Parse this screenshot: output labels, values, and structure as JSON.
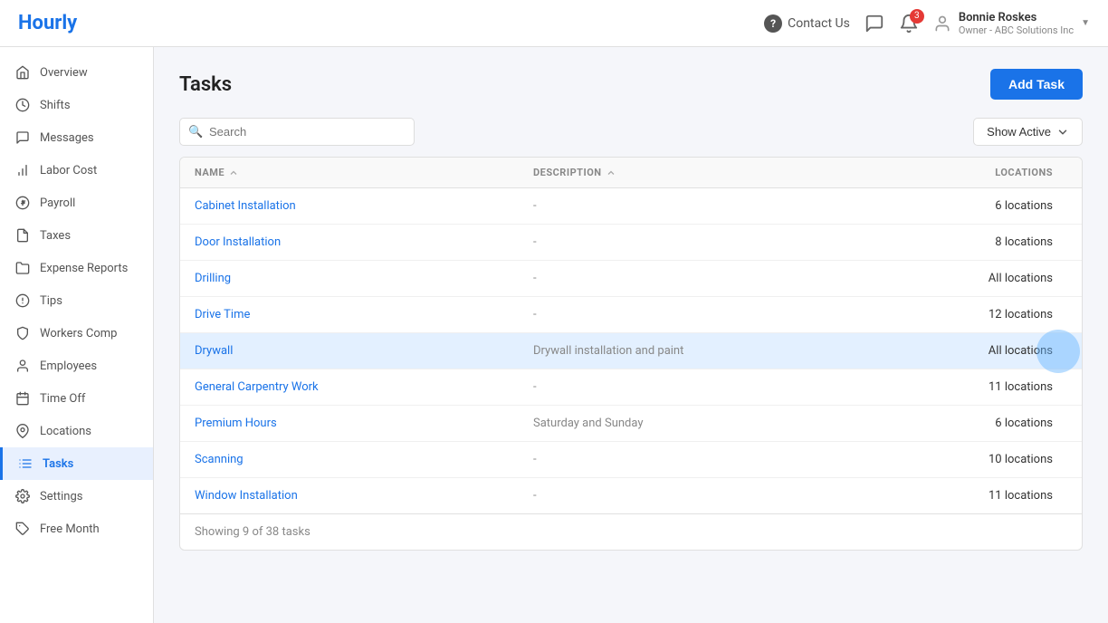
{
  "app": {
    "logo": "Hourly"
  },
  "topnav": {
    "help_label": "Contact Us",
    "notification_count": "3",
    "user_name": "Bonnie Roskes",
    "user_role": "Owner - ABC Solutions Inc"
  },
  "sidebar": {
    "items": [
      {
        "id": "overview",
        "label": "Overview",
        "icon": "home"
      },
      {
        "id": "shifts",
        "label": "Shifts",
        "icon": "clock"
      },
      {
        "id": "messages",
        "label": "Messages",
        "icon": "message"
      },
      {
        "id": "labor-cost",
        "label": "Labor Cost",
        "icon": "chart"
      },
      {
        "id": "payroll",
        "label": "Payroll",
        "icon": "dollar"
      },
      {
        "id": "taxes",
        "label": "Taxes",
        "icon": "file"
      },
      {
        "id": "expense-reports",
        "label": "Expense Reports",
        "icon": "folder"
      },
      {
        "id": "tips",
        "label": "Tips",
        "icon": "tips"
      },
      {
        "id": "workers-comp",
        "label": "Workers Comp",
        "icon": "shield"
      },
      {
        "id": "employees",
        "label": "Employees",
        "icon": "person"
      },
      {
        "id": "time-off",
        "label": "Time Off",
        "icon": "calendar"
      },
      {
        "id": "locations",
        "label": "Locations",
        "icon": "pin"
      },
      {
        "id": "tasks",
        "label": "Tasks",
        "icon": "tasks",
        "active": true
      },
      {
        "id": "settings",
        "label": "Settings",
        "icon": "gear"
      },
      {
        "id": "free-month",
        "label": "Free Month",
        "icon": "tag"
      }
    ]
  },
  "page": {
    "title": "Tasks",
    "add_button_label": "Add Task"
  },
  "toolbar": {
    "search_placeholder": "Search",
    "show_active_label": "Show Active"
  },
  "table": {
    "headers": {
      "name": "NAME",
      "description": "DESCRIPTION",
      "locations": "LOCATIONS"
    },
    "rows": [
      {
        "name": "Cabinet Installation",
        "description": "-",
        "locations": "6 locations"
      },
      {
        "name": "Door Installation",
        "description": "-",
        "locations": "8 locations"
      },
      {
        "name": "Drilling",
        "description": "-",
        "locations": "All locations"
      },
      {
        "name": "Drive Time",
        "description": "-",
        "locations": "12 locations"
      },
      {
        "name": "Drywall",
        "description": "Drywall installation and paint",
        "locations": "All locations",
        "highlight": true
      },
      {
        "name": "General Carpentry Work",
        "description": "-",
        "locations": "11 locations"
      },
      {
        "name": "Premium Hours",
        "description": "Saturday and Sunday",
        "locations": "6 locations"
      },
      {
        "name": "Scanning",
        "description": "-",
        "locations": "10 locations"
      },
      {
        "name": "Window Installation",
        "description": "-",
        "locations": "11 locations"
      }
    ],
    "footer": "Showing 9 of 38 tasks"
  }
}
